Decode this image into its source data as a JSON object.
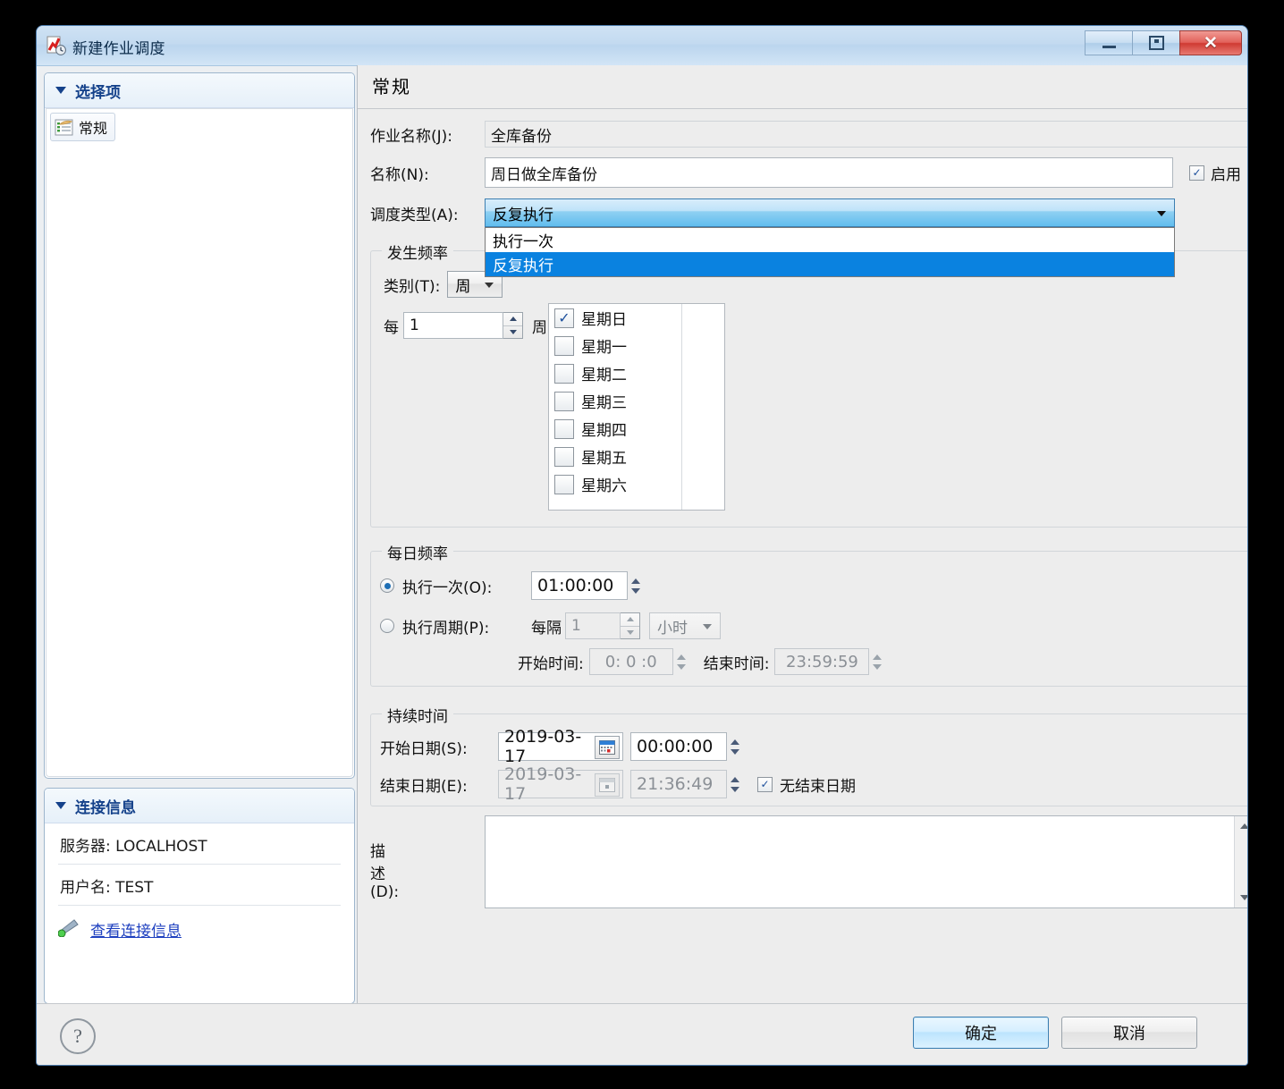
{
  "window": {
    "title": "新建作业调度",
    "icon": "schedule-clock-icon",
    "buttons": {
      "minimize": "–",
      "maximize": "□",
      "close": "x"
    }
  },
  "sidebar": {
    "selection_panel": {
      "title": "选择项",
      "items": [
        {
          "label": "常规",
          "icon": "general-page-icon"
        }
      ]
    },
    "connection_panel": {
      "title": "连接信息",
      "server": "服务器: LOCALHOST",
      "user": "用户名: TEST",
      "link": "查看连接信息",
      "link_icon": "connection-icon"
    }
  },
  "page": {
    "header": "常规",
    "job_name_label": "作业名称(J):",
    "job_name_value": "全库备份",
    "name_label": "名称(N):",
    "name_value": "周日做全库备份",
    "enabled_label": "启用",
    "enabled_checked": true,
    "schedule_type_label": "调度类型(A):",
    "schedule_type_value": "反复执行",
    "schedule_type_options": [
      "执行一次",
      "反复执行"
    ],
    "schedule_type_selected_index": 1
  },
  "frequency": {
    "title": "发生频率",
    "category_label": "类别(T):",
    "category_value": "周",
    "every_prefix": "每",
    "every_value": "1",
    "every_suffix": "周",
    "days": [
      {
        "label": "星期日",
        "checked": true
      },
      {
        "label": "星期一",
        "checked": false
      },
      {
        "label": "星期二",
        "checked": false
      },
      {
        "label": "星期三",
        "checked": false
      },
      {
        "label": "星期四",
        "checked": false
      },
      {
        "label": "星期五",
        "checked": false
      },
      {
        "label": "星期六",
        "checked": false
      }
    ]
  },
  "daily": {
    "title": "每日频率",
    "once_label": "执行一次(O):",
    "once_selected": true,
    "once_time": "01:00:00",
    "periodic_label": "执行周期(P):",
    "periodic_selected": false,
    "interval_prefix": "每隔",
    "interval_value": "1",
    "interval_unit": "小时",
    "start_time_label": "开始时间:",
    "start_time_value": "0: 0 :0",
    "end_time_label": "结束时间:",
    "end_time_value": "23:59:59"
  },
  "duration": {
    "title": "持续时间",
    "start_date_label": "开始日期(S):",
    "start_date_value": "2019-03-17",
    "start_date_time": "00:00:00",
    "end_date_label": "结束日期(E):",
    "end_date_value": "2019-03-17",
    "end_date_time": "21:36:49",
    "no_end_label": "无结束日期",
    "no_end_checked": true,
    "calendar_icon": "calendar-icon"
  },
  "description": {
    "label": "描述(D):",
    "value": ""
  },
  "footer": {
    "help": "?",
    "ok": "确定",
    "cancel": "取消"
  }
}
